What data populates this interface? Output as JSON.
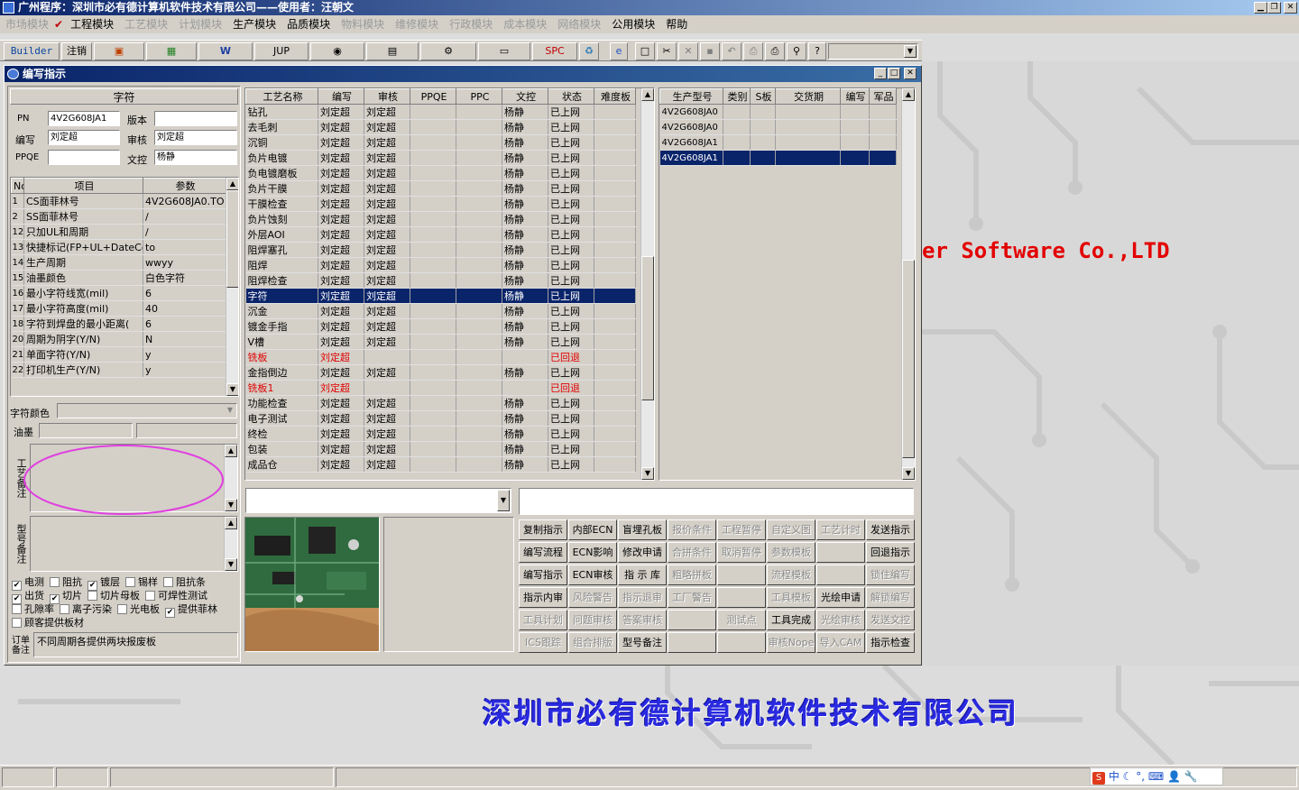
{
  "app": {
    "title": "广州程序：深圳市必有德计算机软件技术有限公司——使用者：汪朝文"
  },
  "menu": [
    {
      "label": "市场模块",
      "enabled": false
    },
    {
      "label": "工程模块",
      "enabled": true,
      "checked": true
    },
    {
      "label": "工艺模块",
      "enabled": false
    },
    {
      "label": "计划模块",
      "enabled": false
    },
    {
      "label": "生产模块",
      "enabled": true
    },
    {
      "label": "品质模块",
      "enabled": true
    },
    {
      "label": "物料模块",
      "enabled": false
    },
    {
      "label": "维修模块",
      "enabled": false
    },
    {
      "label": "行政模块",
      "enabled": false
    },
    {
      "label": "成本模块",
      "enabled": false
    },
    {
      "label": "网络模块",
      "enabled": false
    },
    {
      "label": "公用模块",
      "enabled": true
    },
    {
      "label": "帮助",
      "enabled": true
    }
  ],
  "toolbar": {
    "builder": "Builder",
    "logout": "注销",
    "jup": "JUP",
    "spc": "SPC",
    "icons": [
      "powerpoint-icon",
      "excel-icon",
      "word-icon",
      "eye-icon",
      "database-icon",
      "tools-icon",
      "computer-icon",
      "recycle-icon",
      "ie-icon",
      "new-icon",
      "cut-icon",
      "delete-icon",
      "save-icon",
      "undo-icon",
      "preview-icon",
      "print-icon",
      "find-icon",
      "help-icon"
    ]
  },
  "background": {
    "watermark": "er Software Co.,LTD",
    "company": "深圳市必有德计算机软件技术有限公司"
  },
  "window": {
    "title": "编写指示"
  },
  "left": {
    "section_title": "字符",
    "pn_label": "PN",
    "pn_value": "4V2G608JA1",
    "version_label": "版本",
    "version_value": "",
    "author_label": "编写",
    "author_value": "刘定超",
    "review_label": "审核",
    "review_value": "刘定超",
    "ppqe_label": "PPQE",
    "ppqe_value": "",
    "control_label": "文控",
    "control_value": "杨静",
    "params_headers": [
      "No",
      "项目",
      "参数"
    ],
    "params": [
      [
        "1",
        "CS面菲林号",
        "4V2G608JA0.TO"
      ],
      [
        "2",
        "SS面菲林号",
        "/"
      ],
      [
        "12",
        "只加UL和周期",
        "/"
      ],
      [
        "13",
        "快捷标记(FP+UL+DateCo",
        "to"
      ],
      [
        "14",
        "生产周期",
        "wwyy"
      ],
      [
        "15",
        "油墨颜色",
        "白色字符"
      ],
      [
        "16",
        "最小字符线宽(mil)",
        "6"
      ],
      [
        "17",
        "最小字符高度(mil)",
        "40"
      ],
      [
        "18",
        "字符到焊盘的最小距离(",
        "6"
      ],
      [
        "20",
        "周期为阴字(Y/N)",
        "N"
      ],
      [
        "21",
        "单面字符(Y/N)",
        "y"
      ],
      [
        "22",
        "打印机生产(Y/N)",
        "y"
      ]
    ],
    "char_color_label": "字符颜色",
    "char_color_value": "",
    "ink_label": "油墨",
    "process_note_label": "工艺备注",
    "model_note_label": "型号备注",
    "checkboxes": [
      [
        {
          "label": "电测",
          "checked": true
        },
        {
          "label": "阻抗",
          "checked": false
        },
        {
          "label": "镀层",
          "checked": true
        },
        {
          "label": "锡样",
          "checked": false
        },
        {
          "label": "阻抗条",
          "checked": false
        }
      ],
      [
        {
          "label": "出货",
          "checked": true
        },
        {
          "label": "切片",
          "checked": true
        },
        {
          "label": "切片母板",
          "checked": false
        },
        {
          "label": "可焊性测试",
          "checked": false
        }
      ],
      [
        {
          "label": "孔隙率",
          "checked": false
        },
        {
          "label": "离子污染",
          "checked": false
        },
        {
          "label": "光电板",
          "checked": false
        },
        {
          "label": "提供菲林",
          "checked": true
        }
      ],
      [
        {
          "label": "顾客提供板材",
          "checked": false
        }
      ]
    ],
    "order_note_label": "订单备注",
    "order_note_value": "不同周期各提供两块报废板"
  },
  "process_table": {
    "headers": [
      "工艺名称",
      "编写",
      "审核",
      "PPQE",
      "PPC",
      "文控",
      "状态",
      "难度板"
    ],
    "rows": [
      {
        "cells": [
          "钻孔",
          "刘定超",
          "刘定超",
          "",
          "",
          "杨静",
          "已上网",
          ""
        ],
        "state": "normal"
      },
      {
        "cells": [
          "去毛刺",
          "刘定超",
          "刘定超",
          "",
          "",
          "杨静",
          "已上网",
          ""
        ],
        "state": "normal"
      },
      {
        "cells": [
          "沉铜",
          "刘定超",
          "刘定超",
          "",
          "",
          "杨静",
          "已上网",
          ""
        ],
        "state": "normal"
      },
      {
        "cells": [
          "负片电镀",
          "刘定超",
          "刘定超",
          "",
          "",
          "杨静",
          "已上网",
          ""
        ],
        "state": "normal"
      },
      {
        "cells": [
          "负电镀磨板",
          "刘定超",
          "刘定超",
          "",
          "",
          "杨静",
          "已上网",
          ""
        ],
        "state": "normal"
      },
      {
        "cells": [
          "负片干膜",
          "刘定超",
          "刘定超",
          "",
          "",
          "杨静",
          "已上网",
          ""
        ],
        "state": "normal"
      },
      {
        "cells": [
          "干膜检查",
          "刘定超",
          "刘定超",
          "",
          "",
          "杨静",
          "已上网",
          ""
        ],
        "state": "normal"
      },
      {
        "cells": [
          "负片蚀刻",
          "刘定超",
          "刘定超",
          "",
          "",
          "杨静",
          "已上网",
          ""
        ],
        "state": "normal"
      },
      {
        "cells": [
          "外层AOI",
          "刘定超",
          "刘定超",
          "",
          "",
          "杨静",
          "已上网",
          ""
        ],
        "state": "normal"
      },
      {
        "cells": [
          "阻焊塞孔",
          "刘定超",
          "刘定超",
          "",
          "",
          "杨静",
          "已上网",
          ""
        ],
        "state": "normal"
      },
      {
        "cells": [
          "阻焊",
          "刘定超",
          "刘定超",
          "",
          "",
          "杨静",
          "已上网",
          ""
        ],
        "state": "normal"
      },
      {
        "cells": [
          "阻焊检查",
          "刘定超",
          "刘定超",
          "",
          "",
          "杨静",
          "已上网",
          ""
        ],
        "state": "normal"
      },
      {
        "cells": [
          "字符",
          "刘定超",
          "刘定超",
          "",
          "",
          "杨静",
          "已上网",
          ""
        ],
        "state": "selected"
      },
      {
        "cells": [
          "沉金",
          "刘定超",
          "刘定超",
          "",
          "",
          "杨静",
          "已上网",
          ""
        ],
        "state": "normal"
      },
      {
        "cells": [
          "镀金手指",
          "刘定超",
          "刘定超",
          "",
          "",
          "杨静",
          "已上网",
          ""
        ],
        "state": "normal"
      },
      {
        "cells": [
          "V槽",
          "刘定超",
          "刘定超",
          "",
          "",
          "杨静",
          "已上网",
          ""
        ],
        "state": "normal"
      },
      {
        "cells": [
          "铣板",
          "刘定超",
          "",
          "",
          "",
          "",
          "已回退",
          ""
        ],
        "state": "rejected"
      },
      {
        "cells": [
          "金指倒边",
          "刘定超",
          "刘定超",
          "",
          "",
          "杨静",
          "已上网",
          ""
        ],
        "state": "normal"
      },
      {
        "cells": [
          "铣板1",
          "刘定超",
          "",
          "",
          "",
          "",
          "已回退",
          ""
        ],
        "state": "rejected"
      },
      {
        "cells": [
          "功能检查",
          "刘定超",
          "刘定超",
          "",
          "",
          "杨静",
          "已上网",
          ""
        ],
        "state": "normal"
      },
      {
        "cells": [
          "电子测试",
          "刘定超",
          "刘定超",
          "",
          "",
          "杨静",
          "已上网",
          ""
        ],
        "state": "normal"
      },
      {
        "cells": [
          "终检",
          "刘定超",
          "刘定超",
          "",
          "",
          "杨静",
          "已上网",
          ""
        ],
        "state": "normal"
      },
      {
        "cells": [
          "包装",
          "刘定超",
          "刘定超",
          "",
          "",
          "杨静",
          "已上网",
          ""
        ],
        "state": "normal"
      },
      {
        "cells": [
          "成品仓",
          "刘定超",
          "刘定超",
          "",
          "",
          "杨静",
          "已上网",
          ""
        ],
        "state": "normal"
      }
    ]
  },
  "model_table": {
    "headers": [
      "生产型号",
      "类别",
      "S板",
      "交货期",
      "编写",
      "军品"
    ],
    "rows": [
      {
        "cells": [
          "4V2G608JA0",
          "",
          "",
          "",
          "",
          ""
        ],
        "selected": false
      },
      {
        "cells": [
          "4V2G608JA0",
          "",
          "",
          "",
          "",
          ""
        ],
        "selected": false
      },
      {
        "cells": [
          "4V2G608JA1",
          "",
          "",
          "",
          "",
          ""
        ],
        "selected": false
      },
      {
        "cells": [
          "4V2G608JA1",
          "",
          "",
          "",
          "",
          ""
        ],
        "selected": true
      }
    ]
  },
  "bottom": {
    "combo_value": "",
    "input_value": ""
  },
  "buttons": [
    [
      {
        "label": "复制指示",
        "enabled": true
      },
      {
        "label": "内部ECN",
        "enabled": true
      },
      {
        "label": "盲埋孔板",
        "enabled": true
      },
      {
        "label": "报价条件",
        "enabled": false
      },
      {
        "label": "工程暂停",
        "enabled": false
      },
      {
        "label": "自定义图",
        "enabled": false
      },
      {
        "label": "工艺计时",
        "enabled": false
      },
      {
        "label": "发送指示",
        "enabled": true
      }
    ],
    [
      {
        "label": "编写流程",
        "enabled": true
      },
      {
        "label": "ECN影响",
        "enabled": true
      },
      {
        "label": "修改申请",
        "enabled": true
      },
      {
        "label": "合拼条件",
        "enabled": false
      },
      {
        "label": "取消暂停",
        "enabled": false
      },
      {
        "label": "参数模板",
        "enabled": false
      },
      {
        "label": "",
        "enabled": false
      },
      {
        "label": "回退指示",
        "enabled": true
      }
    ],
    [
      {
        "label": "编写指示",
        "enabled": true
      },
      {
        "label": "ECN审核",
        "enabled": true
      },
      {
        "label": "指 示 库",
        "enabled": true
      },
      {
        "label": "粗略拼板",
        "enabled": false
      },
      {
        "label": "",
        "enabled": false
      },
      {
        "label": "流程模板",
        "enabled": false
      },
      {
        "label": "",
        "enabled": false
      },
      {
        "label": "锁住编写",
        "enabled": false
      }
    ],
    [
      {
        "label": "指示内审",
        "enabled": true
      },
      {
        "label": "风险警告",
        "enabled": false
      },
      {
        "label": "指示退审",
        "enabled": false
      },
      {
        "label": "工厂警告",
        "enabled": false
      },
      {
        "label": "",
        "enabled": false
      },
      {
        "label": "工具模板",
        "enabled": false
      },
      {
        "label": "光绘申请",
        "enabled": true
      },
      {
        "label": "解锁编写",
        "enabled": false
      }
    ],
    [
      {
        "label": "工具计划",
        "enabled": false
      },
      {
        "label": "问题审核",
        "enabled": false
      },
      {
        "label": "答案审核",
        "enabled": false
      },
      {
        "label": "",
        "enabled": false
      },
      {
        "label": "测试点",
        "enabled": false
      },
      {
        "label": "工具完成",
        "enabled": true
      },
      {
        "label": "光绘审核",
        "enabled": false
      },
      {
        "label": "发送文控",
        "enabled": false
      }
    ],
    [
      {
        "label": "ICS跟踪",
        "enabled": false
      },
      {
        "label": "组合排版",
        "enabled": false
      },
      {
        "label": "型号备注",
        "enabled": true
      },
      {
        "label": "",
        "enabled": false
      },
      {
        "label": "",
        "enabled": false
      },
      {
        "label": "审核Nope",
        "enabled": false
      },
      {
        "label": "导入CAM",
        "enabled": false
      },
      {
        "label": "指示检查",
        "enabled": true
      }
    ]
  ],
  "tray": {
    "ime": "中"
  }
}
